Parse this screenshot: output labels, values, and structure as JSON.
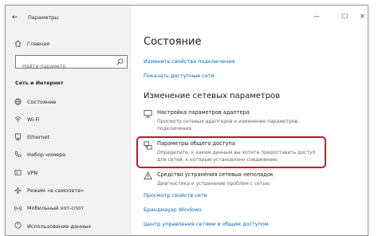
{
  "window": {
    "back_glyph": "←",
    "title": "Параметры",
    "minimize_glyph": "—",
    "maximize_glyph": "☐",
    "close_glyph": "✕"
  },
  "sidebar": {
    "home_label": "Главная",
    "search_placeholder": "Найти параметр",
    "section_title": "Сеть и Интернет",
    "items": [
      {
        "label": "Состояние",
        "icon": "globe-icon"
      },
      {
        "label": "Wi-Fi",
        "icon": "wifi-icon"
      },
      {
        "label": "Ethernet",
        "icon": "ethernet-icon"
      },
      {
        "label": "Набор номера",
        "icon": "phone-icon"
      },
      {
        "label": "VPN",
        "icon": "vpn-icon"
      },
      {
        "label": "Режим «в самолете»",
        "icon": "airplane-icon"
      },
      {
        "label": "Мобильный хот-спот",
        "icon": "hotspot-icon"
      },
      {
        "label": "Использование данных",
        "icon": "data-usage-icon"
      }
    ]
  },
  "main": {
    "title": "Состояние",
    "top_links": [
      "Изменить свойства подключения",
      "Показать доступные сети"
    ],
    "subheading": "Изменение сетевых параметров",
    "settings": [
      {
        "title": "Настройка параметров адаптера",
        "description": "Просмотр сетевых адаптеров и изменение параметров подключения.",
        "icon": "adapter-icon"
      },
      {
        "title": "Параметры общего доступа",
        "description": "Определите, к каким данным вы хотите предоставить доступ для сетей, к которым установлено соединение.",
        "icon": "sharing-icon"
      },
      {
        "title": "Средство устранения сетевых неполадок",
        "description": "Диагностика и устранение проблем с сетью.",
        "icon": "warning-icon"
      }
    ],
    "bottom_links": [
      "Просмотр свойств сети",
      "Брандмауэр Windows",
      "Центр управления сетями и общим доступом"
    ]
  },
  "colors": {
    "accent_link": "#0067b8",
    "highlight": "#c8102e"
  }
}
